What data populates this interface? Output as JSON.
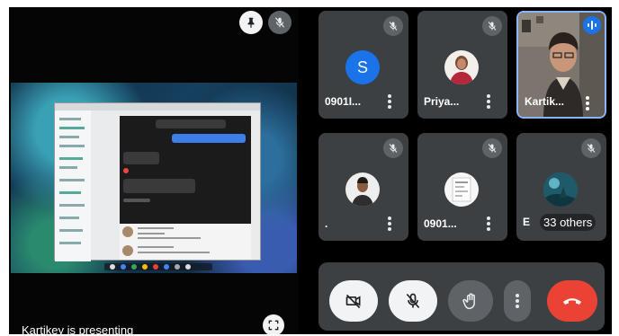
{
  "presentation": {
    "presenter_label": "Kartikey is presenting"
  },
  "participants": [
    {
      "name": "0901I...",
      "avatar_letter": "S",
      "muted": true
    },
    {
      "name": "Priya...",
      "muted": true
    },
    {
      "name": "Kartik...",
      "muted": false,
      "speaking": true
    },
    {
      "name": ".",
      "muted": true
    },
    {
      "name": "0901...",
      "muted": true
    },
    {
      "name": "E",
      "muted": true
    }
  ],
  "others": {
    "label": "33 others"
  },
  "controls": {
    "camera": "camera-off-icon",
    "mic": "mic-off-icon",
    "hand": "raise-hand-icon",
    "more": "more-vert-icon",
    "end": "end-call-icon"
  },
  "colors": {
    "tile_bg": "#3c4043",
    "end_call": "#ea4335",
    "accent_blue": "#1a73e8",
    "active_border": "#8ab4f8"
  }
}
